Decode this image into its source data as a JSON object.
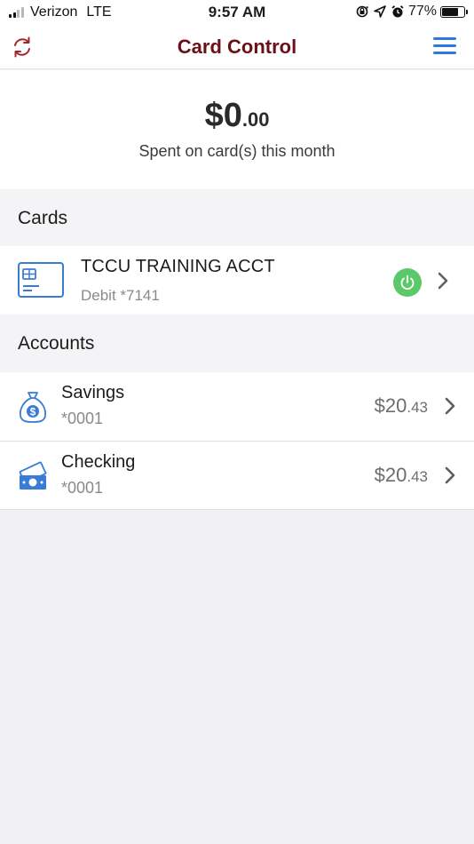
{
  "status_bar": {
    "carrier": "Verizon",
    "network": "LTE",
    "time": "9:57 AM",
    "battery_pct": "77%",
    "battery_level": 0.77,
    "icons": [
      "signal-icon",
      "screen-rotation-lock-icon",
      "location-arrow-icon",
      "alarm-icon",
      "battery-icon"
    ]
  },
  "nav": {
    "title": "Card Control",
    "left_icon": "refresh-icon",
    "right_icon": "hamburger-menu-icon",
    "title_color": "#6b1018",
    "accent_color": "#2f78dd"
  },
  "summary": {
    "amount_main": "$0",
    "amount_cents": ".00",
    "caption": "Spent on card(s) this month"
  },
  "cards_section": {
    "header": "Cards",
    "items": [
      {
        "title": "TCCU TRAINING ACCT",
        "subtitle": "Debit *7141",
        "icon": "credit-card-icon",
        "power_status": "on",
        "power_color": "#5bc96a"
      }
    ]
  },
  "accounts_section": {
    "header": "Accounts",
    "items": [
      {
        "name": "Savings",
        "number": "*0001",
        "balance_main": "$20",
        "balance_cents": ".43",
        "icon": "money-bag-icon"
      },
      {
        "name": "Checking",
        "number": "*0001",
        "balance_main": "$20",
        "balance_cents": ".43",
        "icon": "cash-icon"
      }
    ]
  }
}
